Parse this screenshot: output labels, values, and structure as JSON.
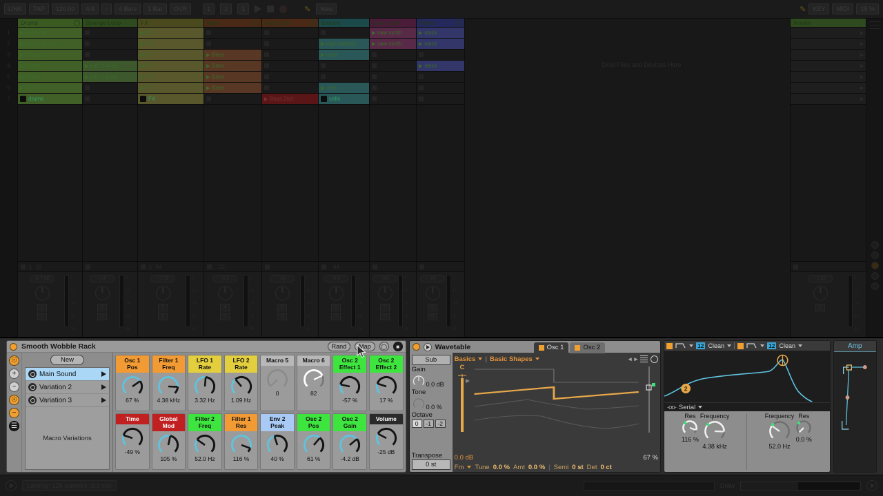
{
  "app": {
    "title": "Ableton Live Session View"
  },
  "toolbar": {
    "chips": [
      "LINK",
      "TAP",
      "120.00",
      "4/4",
      "◦",
      "4 Bars",
      "1 Bar",
      "OVR"
    ],
    "position": [
      "1",
      "1",
      "1"
    ],
    "right_chips": [
      "KEY",
      "MIDI",
      "15 %"
    ],
    "new_label": "New"
  },
  "session": {
    "drop_hint": "Drop Files and Devices Here",
    "scene_numbers": [
      "1",
      "2",
      "3",
      "4",
      "5",
      "6",
      "7"
    ],
    "tracks": [
      {
        "name": "Drums",
        "color": "#3a5a22",
        "clips": [
          {
            "label": "hat loop",
            "state": "stopped"
          },
          {
            "label": "house drums",
            "state": "stopped"
          },
          {
            "label": "drums",
            "state": "stopped"
          },
          {
            "label": "drums",
            "state": "stopped"
          },
          {
            "label": "drums",
            "state": "stopped"
          },
          {
            "label": "drums",
            "state": "stopped"
          },
          {
            "label": "drums",
            "state": "playing"
          }
        ],
        "strip": {
          "a": "1",
          "b": "16"
        },
        "volume": "-4.7 dB",
        "num": "1"
      },
      {
        "name": "Strange Loop",
        "color": "#2e4a1e",
        "clips": [
          {
            "label": "",
            "state": "empty"
          },
          {
            "label": "",
            "state": "empty"
          },
          {
            "label": "",
            "state": "empty"
          },
          {
            "label": "part 1 loop",
            "state": "stopped",
            "alt": true
          },
          {
            "label": "part 1 loop",
            "state": "stopped",
            "alt": true
          },
          {
            "label": "",
            "state": "empty"
          },
          {
            "label": "",
            "state": "empty"
          }
        ],
        "strip": {
          "a": "",
          "b": ""
        },
        "volume": "-inf",
        "num": "2"
      },
      {
        "name": "FX",
        "color": "#4a4a1e",
        "clips": [
          {
            "label": "FX",
            "state": "stopped",
            "alt": true
          },
          {
            "label": "FX",
            "state": "stopped",
            "alt": true
          },
          {
            "label": "FX",
            "state": "stopped",
            "alt": true
          },
          {
            "label": "FX",
            "state": "stopped",
            "alt": true
          },
          {
            "label": "FX",
            "state": "stopped",
            "alt": true
          },
          {
            "label": "FX",
            "state": "stopped",
            "alt": true
          },
          {
            "label": "FX",
            "state": "playing",
            "alt": true
          }
        ],
        "strip": {
          "a": "1",
          "b": "64"
        },
        "volume": "-7.72",
        "num": "3"
      },
      {
        "name": "Bass",
        "color": "#4a2a16",
        "clips": [
          {
            "label": "",
            "state": "empty"
          },
          {
            "label": "",
            "state": "empty"
          },
          {
            "label": "Bass",
            "state": "stopped",
            "alt": true
          },
          {
            "label": "Bass",
            "state": "stopped",
            "alt": true
          },
          {
            "label": "Bass",
            "state": "stopped",
            "alt": true
          },
          {
            "label": "Bass",
            "state": "stopped",
            "alt": true
          },
          {
            "label": "",
            "state": "empty"
          }
        ],
        "strip": {
          "a": "",
          "b": "22"
        },
        "volume": "-3.2",
        "num": "4"
      },
      {
        "name": "Bass 2nd",
        "color": "#4a2a16",
        "clips": [
          {
            "label": "",
            "state": "empty"
          },
          {
            "label": "",
            "state": "empty"
          },
          {
            "label": "",
            "state": "empty"
          },
          {
            "label": "",
            "state": "empty"
          },
          {
            "label": "",
            "state": "empty"
          },
          {
            "label": "",
            "state": "empty"
          },
          {
            "label": "Bass 2nd",
            "state": "selected-red"
          }
        ],
        "strip": {
          "a": "",
          "b": ""
        },
        "volume": "-inf",
        "num": "5"
      },
      {
        "name": "Electric",
        "color": "#1c4a4a",
        "clips": [
          {
            "label": "",
            "state": "empty"
          },
          {
            "label": "high melody",
            "state": "stopped",
            "alt": true
          },
          {
            "label": "cello",
            "state": "stopped",
            "alt": true
          },
          {
            "label": "",
            "state": "empty"
          },
          {
            "label": "",
            "state": "empty"
          },
          {
            "label": "cello",
            "state": "stopped",
            "alt": true
          },
          {
            "label": "cello",
            "state": "playing",
            "alt": true
          }
        ],
        "strip": {
          "a": "",
          "b": "64"
        },
        "volume": "-6.0",
        "num": "6"
      },
      {
        "name": "Saw Synth",
        "color": "#4a1c3a",
        "clips": [
          {
            "label": "saw synth",
            "state": "stopped",
            "alt": true
          },
          {
            "label": "saw synth",
            "state": "stopped",
            "alt": true
          },
          {
            "label": "",
            "state": "empty"
          },
          {
            "label": "",
            "state": "empty"
          },
          {
            "label": "",
            "state": "empty"
          },
          {
            "label": "",
            "state": "empty"
          },
          {
            "label": "",
            "state": "empty"
          }
        ],
        "strip": {
          "a": "",
          "b": ""
        },
        "volume": "-inf",
        "num": "7"
      },
      {
        "name": "Piano",
        "color": "#25285a",
        "clips": [
          {
            "label": "stack",
            "state": "stopped",
            "alt": true
          },
          {
            "label": "stack",
            "state": "stopped",
            "alt": true
          },
          {
            "label": "",
            "state": "empty"
          },
          {
            "label": "stack",
            "state": "stopped",
            "alt": true
          },
          {
            "label": "",
            "state": "empty"
          },
          {
            "label": "",
            "state": "empty"
          },
          {
            "label": "",
            "state": "empty"
          }
        ],
        "strip": {
          "a": "",
          "b": ""
        },
        "volume": "-inf",
        "num": "8"
      }
    ],
    "master": {
      "name": "Master",
      "volume": "-1.52",
      "scene_label": "1"
    }
  },
  "rack": {
    "title": "Smooth Wobble Rack",
    "rand_label": "Rand",
    "map_label": "Map",
    "new_label": "New",
    "macro_variations_label": "Macro Variations",
    "chains": [
      {
        "label": "Main Sound",
        "selected": true
      },
      {
        "label": "Variation 2",
        "selected": false
      },
      {
        "label": "Variation 3",
        "selected": false
      }
    ],
    "macros": [
      {
        "name": "Osc 1\nPos",
        "value": "67 %",
        "angle": 55,
        "color": "#f29a33",
        "text": "#111",
        "knob": "cyan"
      },
      {
        "name": "Filter 1\nFreq",
        "value": "4.38 kHz",
        "angle": 92,
        "color": "#f29a33",
        "text": "#111",
        "knob": "cyan"
      },
      {
        "name": "LFO 1\nRate",
        "value": "3.32 Hz",
        "angle": 5,
        "color": "#e3cf3e",
        "text": "#111",
        "knob": "cyan"
      },
      {
        "name": "LFO 2\nRate",
        "value": "1.09 Hz",
        "angle": -40,
        "color": "#e3cf3e",
        "text": "#111",
        "knob": "cyan"
      },
      {
        "name": "Macro 5",
        "value": "0",
        "angle": -135,
        "color": "#b8b8b8",
        "text": "#111",
        "knob": "none"
      },
      {
        "name": "Macro 6",
        "value": "82",
        "angle": 65,
        "color": "#b8b8b8",
        "text": "#111",
        "knob": "white"
      },
      {
        "name": "Osc 2\nEffect 1",
        "value": "-57 %",
        "angle": -78,
        "color": "#3ee53e",
        "text": "#111",
        "knob": "cyan"
      },
      {
        "name": "Osc 2\nEffect 2",
        "value": "17 %",
        "angle": -72,
        "color": "#3ee53e",
        "text": "#111",
        "knob": "cyan"
      },
      {
        "name": "Time",
        "value": "-49 %",
        "angle": -72,
        "color": "#c02020",
        "text": "#fff",
        "knob": "cyan"
      },
      {
        "name": "Global\nMod",
        "value": "105 %",
        "angle": 12,
        "color": "#c02020",
        "text": "#fff",
        "knob": "cyan"
      },
      {
        "name": "Filter 2\nFreq",
        "value": "52.0 Hz",
        "angle": -55,
        "color": "#3ee53e",
        "text": "#111",
        "knob": "cyan"
      },
      {
        "name": "Filter 1\nRes",
        "value": "116 %",
        "angle": 110,
        "color": "#f29a33",
        "text": "#111",
        "knob": "cyan"
      },
      {
        "name": "Env 2\nPeak",
        "value": "40 %",
        "angle": -18,
        "color": "#a8caf5",
        "text": "#111",
        "knob": "cyan"
      },
      {
        "name": "Osc 2\nPos",
        "value": "61 %",
        "angle": 40,
        "color": "#3ee53e",
        "text": "#111",
        "knob": "cyan"
      },
      {
        "name": "Osc 2\nGain",
        "value": "-4.2 dB",
        "angle": 50,
        "color": "#3ee53e",
        "text": "#111",
        "knob": "cyan"
      },
      {
        "name": "Volume",
        "value": "-25 dB",
        "angle": -62,
        "color": "#2a2a2a",
        "text": "#fff",
        "knob": "cyan"
      }
    ]
  },
  "wavetable": {
    "title": "Wavetable",
    "tabs": [
      {
        "label": "Osc 1",
        "active": true
      },
      {
        "label": "Osc 2",
        "active": false
      }
    ],
    "sub": {
      "button": "Sub",
      "gain_label": "Gain",
      "gain_value": "0.0 dB",
      "tone_label": "Tone",
      "tone_value": "0.0 %",
      "octave_label": "Octave",
      "octaves": [
        "0",
        "-1",
        "-2"
      ],
      "octave_selected": "0",
      "transpose_label": "Transpose",
      "transpose_value": "0 st"
    },
    "category": "Basics",
    "wavetable_name": "Basic Shapes",
    "note_label": "C",
    "gain_value": "0.0 dB",
    "position_value": "67 %",
    "footer": {
      "mode": "Fm",
      "tune_label": "Tune",
      "tune_value": "0.0 %",
      "amt_label": "Amt",
      "amt_value": "0.0 %",
      "semi_label": "Semi",
      "semi_value": "0 st",
      "det_label": "Det",
      "det_value": "0 ct"
    }
  },
  "filter": {
    "filter1": {
      "slope": "12",
      "mode": "Clean"
    },
    "filter2": {
      "slope": "12",
      "mode": "Clean"
    },
    "routing": "Serial",
    "marker": "2",
    "knobs": [
      {
        "label": "Res",
        "value": "116 %",
        "angle": 110
      },
      {
        "label": "Frequency",
        "value": "4.38 kHz",
        "angle": 92
      },
      {
        "label": "Frequency",
        "value": "52.0 Hz",
        "angle": -55
      },
      {
        "label": "Res",
        "value": "0.0 %",
        "angle": -135
      }
    ]
  },
  "amp": {
    "title": "Amp"
  },
  "status": {
    "latency": "Latency: 128 samples (2.9 ms)",
    "draw_label": "Draw",
    "cpu_label": ""
  },
  "colors": {
    "accent_orange": "#f0a030",
    "accent_cyan": "#6fc3e0",
    "macro_green": "#3ee53e",
    "macro_red": "#c02020"
  }
}
